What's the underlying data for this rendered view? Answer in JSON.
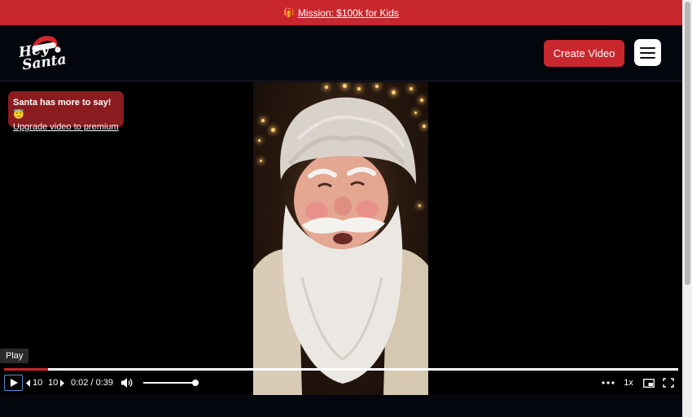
{
  "banner": {
    "icon": "gift-icon",
    "link_text": "Mission: $100k for Kids"
  },
  "header": {
    "logo_line1": "Hey",
    "logo_line2": "Santa",
    "create_button": "Create Video",
    "menu_icon": "hamburger-menu-icon"
  },
  "player": {
    "upsell_title": "Santa has more to say!",
    "upsell_emoji": "😇",
    "upsell_link": "Upgrade video to premium",
    "tooltip": "Play",
    "skip_back": "10",
    "skip_forward": "10",
    "current_time": "0:02",
    "duration": "0:39",
    "time_separator": " / ",
    "speed": "1x",
    "progress_fraction": 0.065,
    "volume_fraction": 1.0
  },
  "colors": {
    "brand_red": "#c8272d",
    "dark_red": "#8a1c20",
    "background": "#04060d"
  }
}
